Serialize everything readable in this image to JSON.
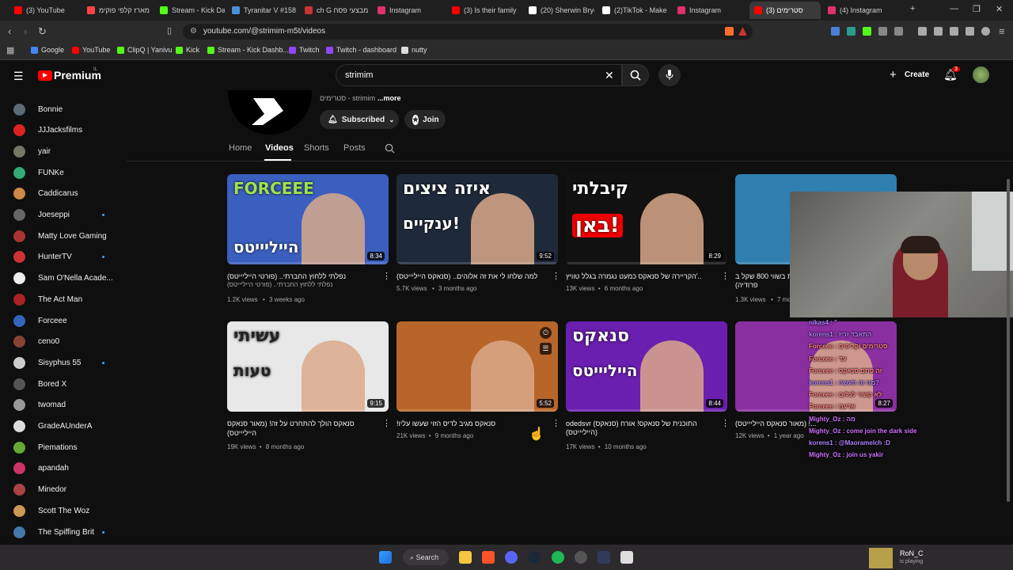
{
  "browser": {
    "tabs": [
      {
        "title": "(3) YouTube",
        "color": "#ff0000"
      },
      {
        "title": "מארז קלפי פוקימ",
        "color": "#ff4444"
      },
      {
        "title": "Stream - Kick Da",
        "color": "#53fc18"
      },
      {
        "title": "Tyranitar V #158",
        "color": "#4a90d9"
      },
      {
        "title": "ch G מבצעי פסח",
        "color": "#cc3333"
      },
      {
        "title": "Instagram",
        "color": "#e1306c"
      },
      {
        "title": "(3) Is their family",
        "color": "#ff0000"
      },
      {
        "title": "(20) Sherwin Bryc",
        "color": "#ffffff"
      },
      {
        "title": "(2)TikTok - Make",
        "color": "#ffffff"
      },
      {
        "title": "Instagram",
        "color": "#e1306c"
      },
      {
        "title": "(3) סטרימים",
        "color": "#ff0000"
      },
      {
        "title": "(4) Instagram",
        "color": "#e1306c"
      }
    ],
    "url": "youtube.com/@strimim-m5t/videos",
    "bookmarks": [
      {
        "label": "Google",
        "color": "#4285f4"
      },
      {
        "label": "YouTube",
        "color": "#ff0000"
      },
      {
        "label": "ClipQ | Yanivu",
        "color": "#53fc18"
      },
      {
        "label": "Kick",
        "color": "#53fc18"
      },
      {
        "label": "Stream - Kick Dashb...",
        "color": "#53fc18"
      },
      {
        "label": "Twitch",
        "color": "#9146ff"
      },
      {
        "label": "Twitch - dashboard",
        "color": "#9146ff"
      },
      {
        "label": "nutty",
        "color": "#dddddd"
      }
    ]
  },
  "youtube": {
    "logo_text": "Premium",
    "logo_sup": "IL",
    "search_value": "strimim",
    "create_label": "Create",
    "notif_count": "3"
  },
  "sidebar": {
    "items": [
      {
        "name": "Bonnie",
        "color": "#5a6b7a",
        "dot": false
      },
      {
        "name": "JJJacksfilms",
        "color": "#d22",
        "dot": false
      },
      {
        "name": "yair",
        "color": "#776",
        "dot": false
      },
      {
        "name": "FUNKe",
        "color": "#3a7",
        "dot": false
      },
      {
        "name": "Caddicarus",
        "color": "#c84",
        "dot": false
      },
      {
        "name": "Joeseppi",
        "color": "#666",
        "dot": true
      },
      {
        "name": "Matty Love Gaming",
        "color": "#a33",
        "dot": false
      },
      {
        "name": "HunterTV",
        "color": "#c33",
        "dot": true
      },
      {
        "name": "Sam O'Nella Acade...",
        "color": "#eee",
        "dot": false
      },
      {
        "name": "The Act Man",
        "color": "#a22",
        "dot": false
      },
      {
        "name": "Forceee",
        "color": "#36b",
        "dot": false
      },
      {
        "name": "ceno0",
        "color": "#843",
        "dot": false
      },
      {
        "name": "Sisyphus 55",
        "color": "#ccc",
        "dot": true
      },
      {
        "name": "Bored X",
        "color": "#555",
        "dot": false
      },
      {
        "name": "twomad",
        "color": "#999",
        "dot": false
      },
      {
        "name": "GradeAUnderA",
        "color": "#ddd",
        "dot": false
      },
      {
        "name": "Piemations",
        "color": "#6a3",
        "dot": false
      },
      {
        "name": "apandah",
        "color": "#c36",
        "dot": false
      },
      {
        "name": "Minedor",
        "color": "#a44",
        "dot": false
      },
      {
        "name": "Scott The Woz",
        "color": "#c95",
        "dot": false
      },
      {
        "name": "The Spiffing Brit",
        "color": "#47a",
        "dot": true
      }
    ]
  },
  "channel": {
    "handle_line": "סטרימים - strimim",
    "more": "...more",
    "subscribed_label": "Subscribed",
    "join_label": "Join",
    "tabs": [
      "Home",
      "Videos",
      "Shorts",
      "Posts"
    ]
  },
  "videos": [
    {
      "title": "נפלתי ללחוץ החברתי.. (פורטי הייליייטס)",
      "sub": "(נפלתי ללחוץ החברתי.. (פורטי הייליייטס",
      "views": "1.2K views",
      "age": "3 weeks ago",
      "duration": "8:34",
      "thumb_text": "FORCEEE",
      "thumb_text2": "הייליייטס",
      "bg": "#3b5fbf"
    },
    {
      "title": "למה שלחו לי את זה אלוהים.. (סנאקס הייליייטס)",
      "sub": "",
      "views": "5.7K views",
      "age": "3 months ago",
      "duration": "9:52",
      "thumb_text": "איזה ציצים",
      "thumb_text2": "ענקיים!",
      "bg": "#1e2a3a"
    },
    {
      "title": "הקריירה של סנאקס כמעט נגמרה בגלל טוויץ'..",
      "sub": "",
      "views": "13K views",
      "age": "6 months ago",
      "duration": "8:29",
      "thumb_text": "קיבלתי",
      "thumb_text2": "באן!",
      "bg": "#111"
    },
    {
      "title": "ת בשווי 800 שקל ב",
      "sub": "(פרודיה",
      "views": "1.3K views",
      "age": "7 mont",
      "duration": "",
      "thumb_text": "",
      "thumb_text2": "",
      "bg": "#2f7fb0"
    },
    {
      "title": "סנאקס הולך להתחרט על זה! (מאור סנאקס הייליייטס)",
      "sub": "",
      "views": "19K views",
      "age": "8 months ago",
      "duration": "9:15",
      "thumb_text": "עשיתי",
      "thumb_text2": "טעות",
      "bg": "#e8e8e8"
    },
    {
      "title": "!סנאקס מגיב לדיס הזוי שעשו עליו",
      "sub": "",
      "views": "21K views",
      "age": "9 months ago",
      "duration": "5:52",
      "thumb_text": "",
      "thumb_text2": "",
      "bg": "#b8652a"
    },
    {
      "title": "odedsvr (סנאקס) התוכנית של סנאקס! אורח",
      "sub": "(הייליייטס)",
      "views": "17K views",
      "age": "10 months ago",
      "duration": "8:44",
      "thumb_text": "סנאקס",
      "thumb_text2": "הייליייטס",
      "bg": "#6a1fb0"
    },
    {
      "title": "(מאור סנאקס הייליייטס) !...",
      "sub": "",
      "views": "12K views",
      "age": "1 year ago",
      "duration": "8:27",
      "thumb_text": "",
      "thumb_text2": "",
      "bg": "#8a2fa0"
    }
  ],
  "chat": [
    {
      "text": "nikas4 : \"",
      "color": "#b080ff"
    },
    {
      "text": "korens1 : התאבד זריז",
      "color": "#b080ff"
    },
    {
      "text": "Forceee : סטרימים וקליפים",
      "color": "#ff8080"
    },
    {
      "text": "Forceee : עד",
      "color": "#ff8080"
    },
    {
      "text": "Forceee : זה סתם סנאקס",
      "color": "#ff8080"
    },
    {
      "text": "korens1 : מה זה תעשה?",
      "color": "#b080ff"
    },
    {
      "text": "Forceee : לא קשור לכלום",
      "color": "#ff8080"
    },
    {
      "text": "Forceee : אדעמ",
      "color": "#ff8080"
    },
    {
      "text": "Mighty_Oz : מה",
      "color": "#d070ff"
    },
    {
      "text": "Mighty_Oz : come join the dark side",
      "color": "#d070ff"
    },
    {
      "text": "korens1 : @Maoramelch :D",
      "color": "#b080ff"
    },
    {
      "text": "Mighty_Oz : join us yakir",
      "color": "#d070ff"
    }
  ],
  "taskbar": {
    "search_label": "Search",
    "now_playing_name": "RoN_C",
    "now_playing_status": "is playing"
  }
}
